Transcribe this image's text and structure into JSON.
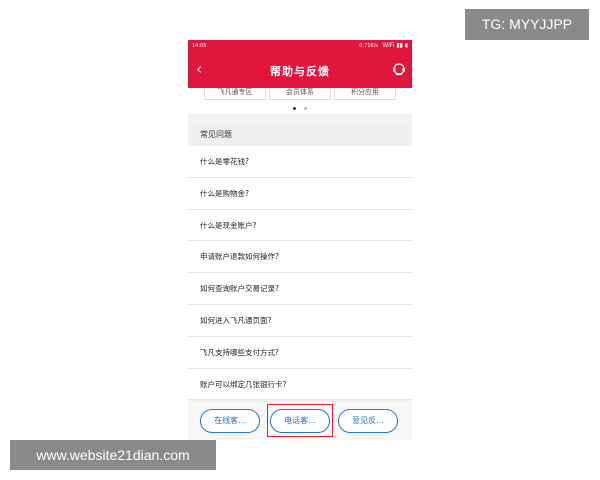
{
  "status_bar": {
    "time": "14:05",
    "network": "0.71K/s",
    "icons": "WiFi ▮▮ ◖"
  },
  "app_bar": {
    "back_icon": "chevron-left-icon",
    "title": "帮助与反馈",
    "service_icon": "customer-service-icon"
  },
  "categories": [
    "飞凡通专区",
    "会员体系",
    "积分应用"
  ],
  "carousel": {
    "dot_count": 2,
    "active_index": 0
  },
  "faq": {
    "header": "常见问题",
    "items": [
      "什么是零花钱?",
      "什么是购物金?",
      "什么是现金账户?",
      "申请账户退款如何操作?",
      "如何查询账户交易记录?",
      "如何进入飞凡通页面?",
      "飞凡支持哪些支付方式?",
      "账户可以绑定几张银行卡?"
    ]
  },
  "bottom_buttons": [
    "在线客...",
    "电话客...",
    "意见反..."
  ],
  "colors": {
    "brand_red": "#e0163d",
    "link_blue": "#2b73c7",
    "highlight_red": "#d9232f"
  },
  "watermarks": {
    "tg": "TG: MYYJJPP",
    "site": "www.website21dian.com"
  }
}
